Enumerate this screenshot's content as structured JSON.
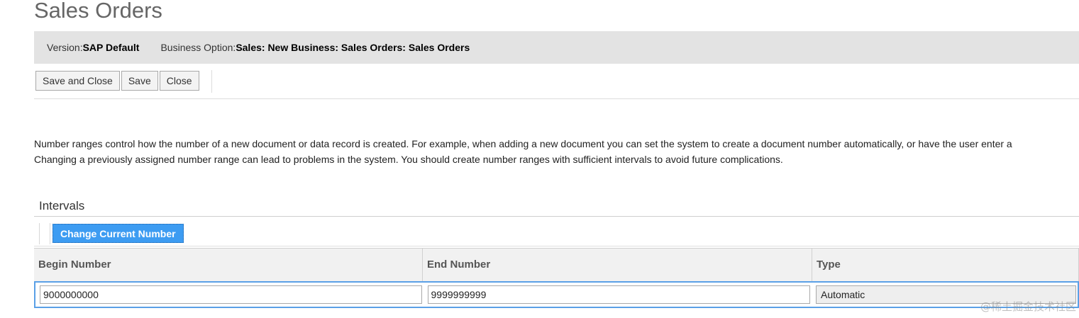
{
  "page": {
    "title": "Sales Orders"
  },
  "info_bar": {
    "version_label": "Version:",
    "version_value": "SAP Default",
    "business_option_label": "Business Option:",
    "business_option_value": "Sales: New Business: Sales Orders: Sales Orders"
  },
  "toolbar": {
    "save_and_close_label": "Save and Close",
    "save_label": "Save",
    "close_label": "Close"
  },
  "description": {
    "line1": "Number ranges control how the number of a new document or data record is created. For example, when adding a new document you can set the system to create a document number automatically, or have the user enter a",
    "line2": "Changing a previously assigned number range can lead to problems in the system. You should create number ranges with sufficient intervals to avoid future complications."
  },
  "intervals": {
    "title": "Intervals",
    "change_current_number_label": "Change Current Number",
    "columns": [
      "Begin Number",
      "End Number",
      "Type"
    ],
    "rows": [
      {
        "begin": "9000000000",
        "end": "9999999999",
        "type": "Automatic"
      }
    ]
  },
  "watermark": "@稀土掘金技术社区",
  "colors": {
    "primary_button": "#3d9cf2",
    "info_bar_bg": "#e3e3e3",
    "selected_row_border": "#5aa0e6"
  }
}
